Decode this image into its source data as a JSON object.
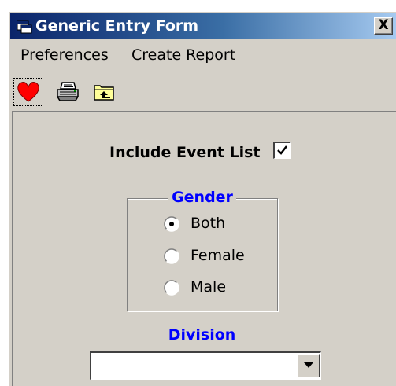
{
  "window": {
    "title": "Generic Entry Form",
    "close_label": "X",
    "title_icon": "app-window-icon"
  },
  "menu": {
    "items": [
      {
        "label": "Preferences"
      },
      {
        "label": "Create Report"
      }
    ]
  },
  "toolbar": {
    "buttons": [
      {
        "icon": "heart-icon",
        "color": "#ff0000"
      },
      {
        "icon": "printer-icon"
      },
      {
        "icon": "folder-up-icon",
        "color": "#ffff99"
      }
    ]
  },
  "form": {
    "include_event_list": {
      "label": "Include Event List",
      "checked": true
    },
    "gender": {
      "legend": "Gender",
      "options": [
        {
          "label": "Both",
          "selected": true
        },
        {
          "label": "Female",
          "selected": false
        },
        {
          "label": "Male",
          "selected": false
        }
      ]
    },
    "division": {
      "label": "Division",
      "value": ""
    }
  },
  "colors": {
    "face": "#d4d0c8",
    "title_start": "#0a246a",
    "title_end": "#a6caf0",
    "accent_label": "#0000ff"
  }
}
